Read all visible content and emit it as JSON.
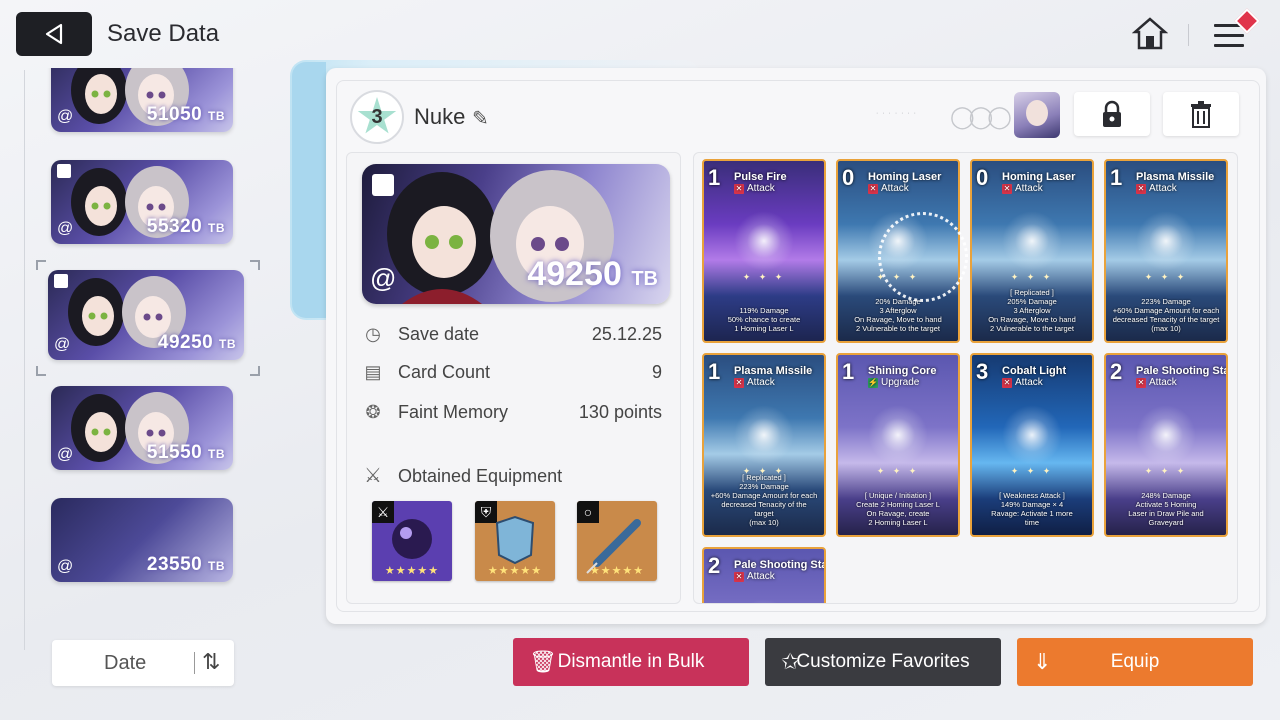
{
  "header": {
    "title": "Save Data"
  },
  "sidebar": {
    "items": [
      {
        "tb": "51050",
        "unit": "TB",
        "locked": false,
        "has_characters": true
      },
      {
        "tb": "55320",
        "unit": "TB",
        "locked": true,
        "has_characters": true
      },
      {
        "tb": "49250",
        "unit": "TB",
        "locked": true,
        "has_characters": true,
        "selected": true
      },
      {
        "tb": "51550",
        "unit": "TB",
        "locked": false,
        "has_characters": true
      },
      {
        "tb": "23550",
        "unit": "TB",
        "locked": false,
        "has_characters": false
      }
    ],
    "sort_label": "Date"
  },
  "save": {
    "level": "3",
    "name": "Nuke",
    "tb": "49250",
    "unit": "TB",
    "details": [
      {
        "label": "Save date",
        "value": "25.12.25",
        "icon": "clock-icon"
      },
      {
        "label": "Card Count",
        "value": "9",
        "icon": "cards-icon"
      },
      {
        "label": "Faint Memory",
        "value": "130 points",
        "icon": "brain-icon"
      }
    ],
    "equipment_title": "Obtained Equipment",
    "equipment": [
      {
        "slot_icon": "sword-icon",
        "rarity_stars": "★★★★★",
        "color": "#5b3fb0"
      },
      {
        "slot_icon": "armor-icon",
        "rarity_stars": "★★★★★",
        "color": "#c98a4a"
      },
      {
        "slot_icon": "ring-icon",
        "rarity_stars": "★★★★★",
        "color": "#c98a4a"
      }
    ]
  },
  "cards": [
    {
      "cost": "1",
      "name": "Pulse Fire",
      "type": "Attack",
      "style": "purple",
      "desc": "119% Damage\n50% chance to create\n1 Homing Laser L"
    },
    {
      "cost": "0",
      "name": "Homing Laser",
      "type": "Attack",
      "style": "blue",
      "desc": "20% Damage\n3 Afterglow\nOn Ravage, Move to hand\n2 Vulnerable to the target"
    },
    {
      "cost": "0",
      "name": "Homing Laser",
      "type": "Attack",
      "style": "blue",
      "desc": "[ Replicated ]\n205% Damage\n3 Afterglow\nOn Ravage, Move to hand\n2 Vulnerable to the target"
    },
    {
      "cost": "1",
      "name": "Plasma Missile",
      "type": "Attack",
      "style": "blue",
      "desc": "223% Damage\n+60% Damage Amount for each\ndecreased Tenacity of the target\n(max 10)"
    },
    {
      "cost": "1",
      "name": "Plasma Missile",
      "type": "Attack",
      "style": "blue",
      "desc": "[ Replicated ]\n223% Damage\n+60% Damage Amount for each\ndecreased Tenacity of the\ntarget\n(max 10)"
    },
    {
      "cost": "1",
      "name": "Shining Core",
      "type": "Upgrade",
      "style": "violet",
      "desc": "[ Unique / Initiation ]\nCreate 2 Homing Laser L\nOn Ravage, create\n2 Homing Laser L"
    },
    {
      "cost": "3",
      "name": "Cobalt Light",
      "type": "Attack",
      "style": "cobalt",
      "desc": "[ Weakness Attack ]\n149% Damage × 4\nRavage: Activate 1 more\ntime"
    },
    {
      "cost": "2",
      "name": "Pale Shooting Star",
      "type": "Attack",
      "style": "violet",
      "desc": "248% Damage\nActivate 5 Homing\nLaser in Draw Pile and\nGraveyard"
    },
    {
      "cost": "2",
      "name": "Pale Shooting Star",
      "type": "Attack",
      "style": "violet",
      "desc": ""
    }
  ],
  "actions": {
    "dismantle": "Dismantle in Bulk",
    "customize": "Customize Favorites",
    "equip": "Equip"
  },
  "colors": {
    "dismantle": "#c8325a",
    "customize": "#3a3b40",
    "equip": "#ec7a2e"
  }
}
